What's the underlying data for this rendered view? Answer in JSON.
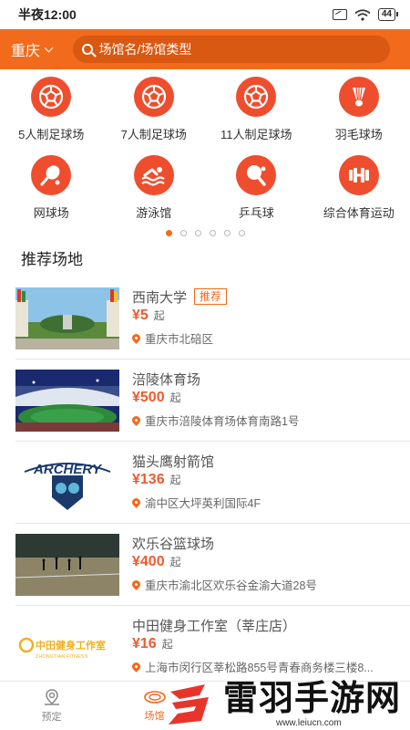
{
  "status_bar": {
    "time": "半夜12:00",
    "battery": "44"
  },
  "header": {
    "city": "重庆",
    "search_placeholder": "场馆名/场馆类型"
  },
  "categories": [
    {
      "label": "5人制足球场",
      "icon": "soccer-ball-icon"
    },
    {
      "label": "7人制足球场",
      "icon": "soccer-ball-icon"
    },
    {
      "label": "11人制足球场",
      "icon": "soccer-ball-icon"
    },
    {
      "label": "羽毛球场",
      "icon": "shuttlecock-icon"
    },
    {
      "label": "网球场",
      "icon": "tennis-racket-icon"
    },
    {
      "label": "游泳馆",
      "icon": "swimmer-icon"
    },
    {
      "label": "乒乓球",
      "icon": "ping-pong-paddle-icon"
    },
    {
      "label": "综合体育运动",
      "icon": "dumbbell-icon"
    }
  ],
  "pager": {
    "count": 6,
    "active": 0
  },
  "section_title": "推荐场地",
  "venues": [
    {
      "name": "西南大学",
      "tag": "推荐",
      "price": "¥5",
      "unit": "起",
      "address": "重庆市北碚区"
    },
    {
      "name": "涪陵体育场",
      "tag": "",
      "price": "¥500",
      "unit": "起",
      "address": "重庆市涪陵体育场体育南路1号"
    },
    {
      "name": "猫头鹰射箭馆",
      "tag": "",
      "price": "¥136",
      "unit": "起",
      "address": "渝中区大坪英利国际4F"
    },
    {
      "name": "欢乐谷篮球场",
      "tag": "",
      "price": "¥400",
      "unit": "起",
      "address": "重庆市渝北区欢乐谷金渝大道28号"
    },
    {
      "name": "中田健身工作室（莘庄店）",
      "tag": "",
      "price": "¥16",
      "unit": "起",
      "address": "上海市闵行区莘松路855号青春商务楼三楼8..."
    }
  ],
  "thumb_text": {
    "archery": "ARCHERY",
    "gym": "中田健身工作室",
    "gym_sub": "ZHONGTIAN FITNESS"
  },
  "bottom_nav": [
    {
      "label": "预定",
      "icon": "booking-icon"
    },
    {
      "label": "场馆",
      "icon": "stadium-icon"
    }
  ],
  "watermark": {
    "title": "雷羽手游网",
    "url": "www.leiucn.com"
  },
  "colors": {
    "accent": "#f26a1b",
    "icon_red": "#ee4e2e",
    "price": "#ee5a2e"
  }
}
